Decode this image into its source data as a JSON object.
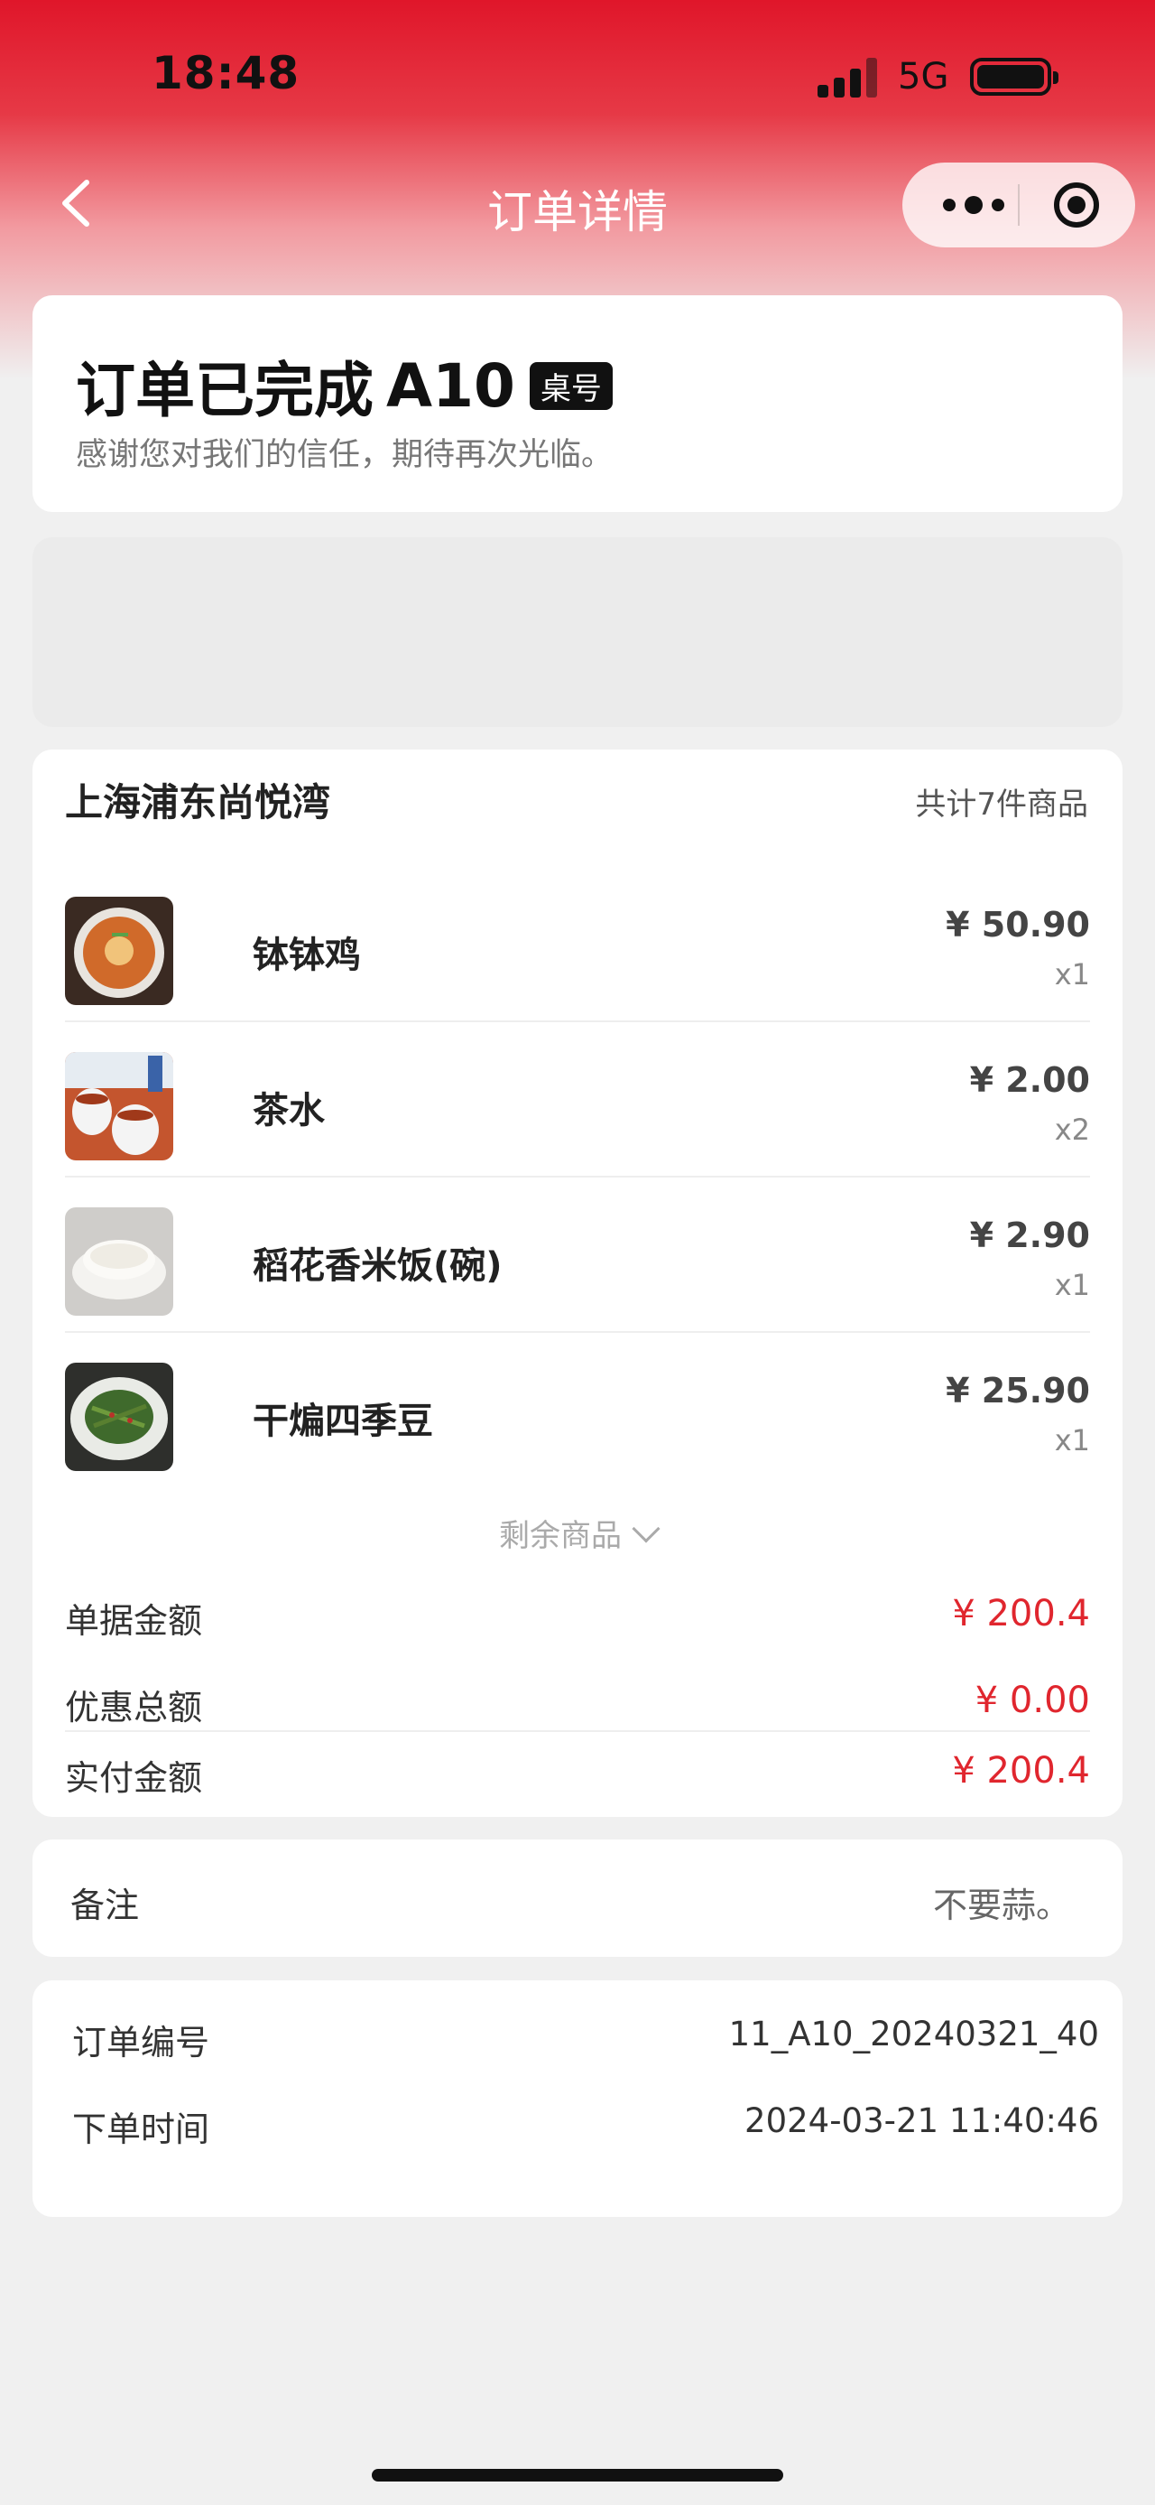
{
  "status_bar": {
    "time": "18:48",
    "network": "5G"
  },
  "nav": {
    "title": "订单详情"
  },
  "order_status": {
    "title": "订单已完成",
    "table_number": "A10",
    "table_badge": "桌号",
    "subtitle": "感谢您对我们的信任，期待再次光临。"
  },
  "order": {
    "store_name": "上海浦东尚悦湾",
    "item_count": "共计7件商品",
    "items": [
      {
        "name": "钵钵鸡",
        "price": "¥ 50.90",
        "qty": "x1",
        "thumb_color": "#c8642e"
      },
      {
        "name": "茶水",
        "price": "¥ 2.00",
        "qty": "x2",
        "thumb_color": "#b0462c"
      },
      {
        "name": "稻花香米饭(碗)",
        "price": "¥ 2.90",
        "qty": "x1",
        "thumb_color": "#d9d5ce"
      },
      {
        "name": "干煸四季豆",
        "price": "¥ 25.90",
        "qty": "x1",
        "thumb_color": "#3d5a2e"
      }
    ],
    "more_items_label": "剩余商品",
    "summary": [
      {
        "label": "单据金额",
        "value": "¥ 200.4"
      },
      {
        "label": "优惠总额",
        "value": "¥ 0.00"
      },
      {
        "label": "实付金额",
        "value": "¥ 200.4"
      }
    ]
  },
  "note": {
    "label": "备注",
    "value": "不要蒜。"
  },
  "info": [
    {
      "label": "订单编号",
      "value": "11_A10_20240321_40"
    },
    {
      "label": "下单时间",
      "value": "2024-03-21 11:40:46"
    }
  ],
  "colors": {
    "accent": "#e0262e",
    "header_red": "#e0162a"
  }
}
